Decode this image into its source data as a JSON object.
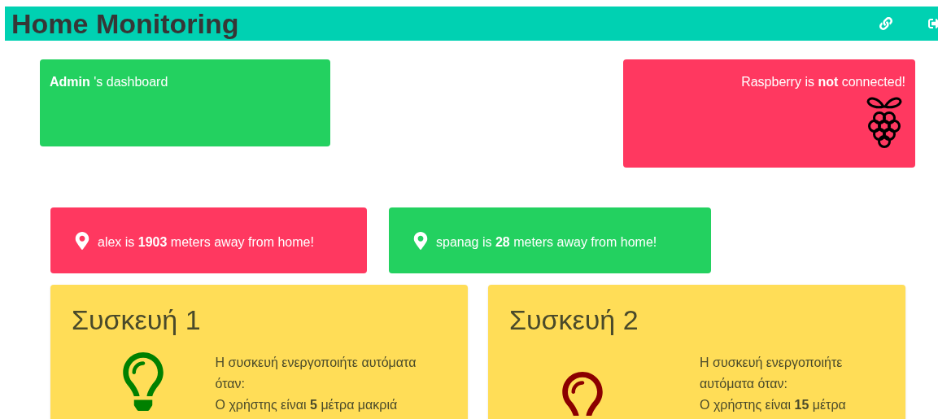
{
  "header": {
    "title": "Home Monitoring"
  },
  "dashboard_card": {
    "text": "**Admin** 's dashboard"
  },
  "raspberry_card": {
    "text": "Raspberry is **not** connected!",
    "connected": false
  },
  "user_locations": [
    {
      "text": "alex is **1903** meters away from home!",
      "near": false
    },
    {
      "text": "spanag is **28** meters away from home!",
      "near": true
    }
  ],
  "devices": [
    {
      "title": "Συσκευή 1",
      "on": true,
      "lines": [
        "Η συσκευή ενεργοποιήτε αυτόματα όταν:",
        "Ο χρήστης είναι **5** μέτρα μακριά"
      ]
    },
    {
      "title": "Συσκευή 2",
      "on": false,
      "lines": [
        "Η συσκευή ενεργοποιήτε αυτόματα όταν:",
        "Ο χρήστης είναι **15** μέτρα"
      ]
    }
  ]
}
